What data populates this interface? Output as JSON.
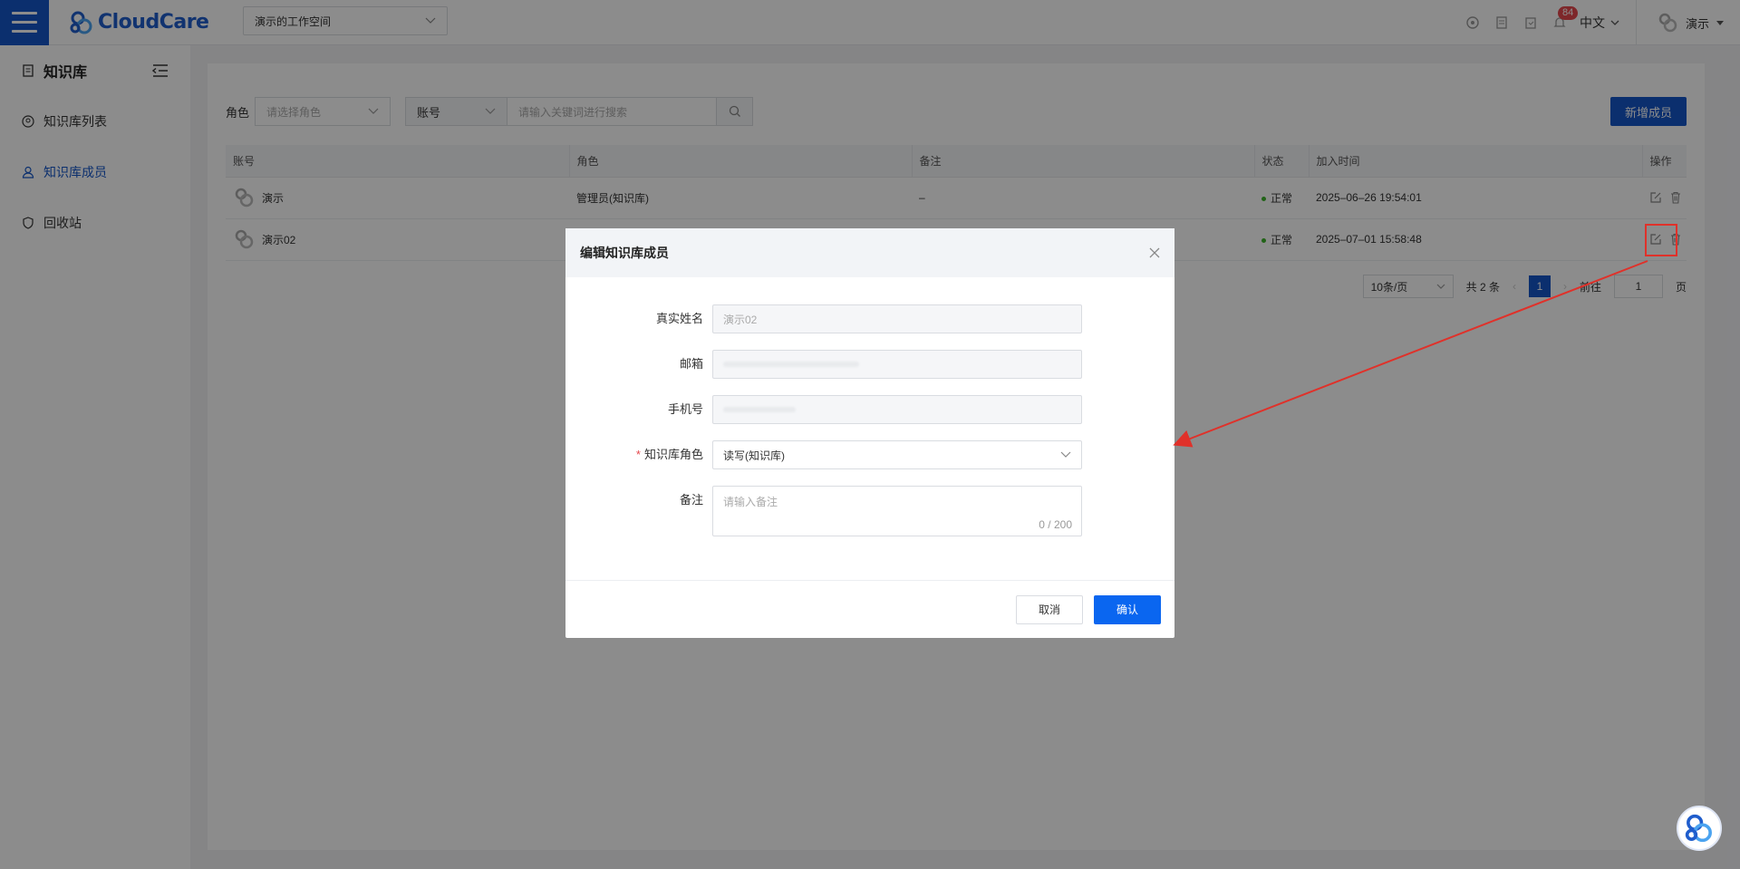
{
  "app": {
    "logo_text": "CloudCare",
    "workspace": "演示的工作空间"
  },
  "header": {
    "notification_count": "84",
    "language": "中文",
    "user_name": "演示"
  },
  "sidebar": {
    "title": "知识库",
    "items": [
      {
        "label": "知识库列表",
        "icon": "user-circle-icon"
      },
      {
        "label": "知识库成员",
        "icon": "user-icon"
      },
      {
        "label": "回收站",
        "icon": "shield-icon"
      }
    ]
  },
  "filter": {
    "role_label": "角色",
    "role_placeholder": "请选择角色",
    "field_select": "账号",
    "search_placeholder": "请输入关键词进行搜索",
    "add_button": "新增成员"
  },
  "table": {
    "columns": [
      "账号",
      "角色",
      "备注",
      "状态",
      "加入时间",
      "操作"
    ],
    "rows": [
      {
        "account": "演示",
        "role": "管理员(知识库)",
        "remark": "–",
        "status": "正常",
        "joined": "2025–06–26 19:54:01"
      },
      {
        "account": "演示02",
        "role": "",
        "remark": "",
        "status": "正常",
        "joined": "2025–07–01 15:58:48"
      }
    ]
  },
  "pager": {
    "page_size": "10条/页",
    "total": "共 2 条",
    "current": "1",
    "goto_label": "前往",
    "goto_value": "1",
    "page_suffix": "页"
  },
  "modal": {
    "title": "编辑知识库成员",
    "name_label": "真实姓名",
    "name_value": "演示02",
    "email_label": "邮箱",
    "phone_label": "手机号",
    "role_label": "知识库角色",
    "role_value": "读写(知识库)",
    "remark_label": "备注",
    "remark_placeholder": "请输入备注",
    "remark_counter": "0 / 200",
    "cancel": "取消",
    "confirm": "确认"
  },
  "colors": {
    "brand": "#1456c8",
    "primary_button": "#0a66f0",
    "annotation": "#e0312a",
    "status_ok": "#3cb52b"
  }
}
